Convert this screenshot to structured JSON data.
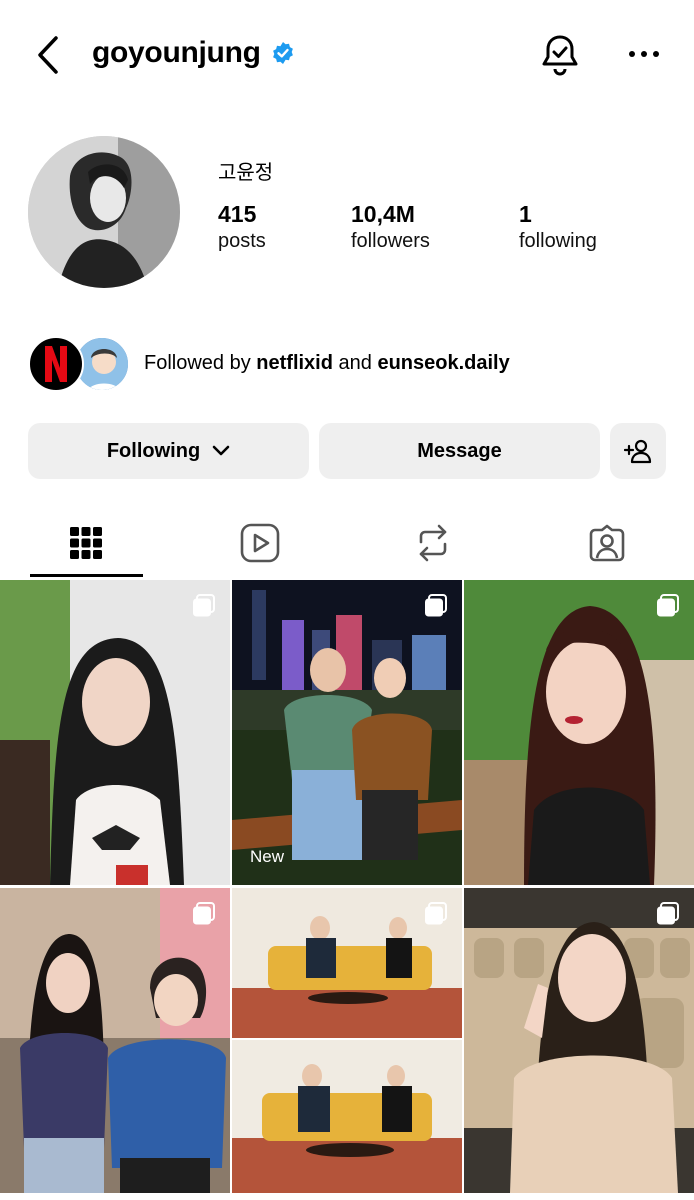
{
  "header": {
    "username": "goyounjung",
    "icons": [
      "back-chevron-icon",
      "verified-badge-icon",
      "notification-bell-icon",
      "more-options-icon"
    ]
  },
  "profile": {
    "display_name": "고윤정",
    "stats": [
      {
        "value": "415",
        "label": "posts"
      },
      {
        "value": "10,4M",
        "label": "followers"
      },
      {
        "value": "1",
        "label": "following"
      }
    ]
  },
  "followed_by": {
    "prefix": "Followed by",
    "user1": "netflixid",
    "conj": "and",
    "user2": "eunseok.daily"
  },
  "buttons": {
    "following": "Following",
    "message": "Message"
  },
  "tabs": [
    "posts-grid-icon",
    "reels-icon",
    "reposts-icon",
    "tagged-icon"
  ],
  "grid": {
    "new_label": "New"
  },
  "colors": {
    "verified": "#1d9bf0",
    "button_bg": "#efefef",
    "netflix_red": "#e50914"
  }
}
